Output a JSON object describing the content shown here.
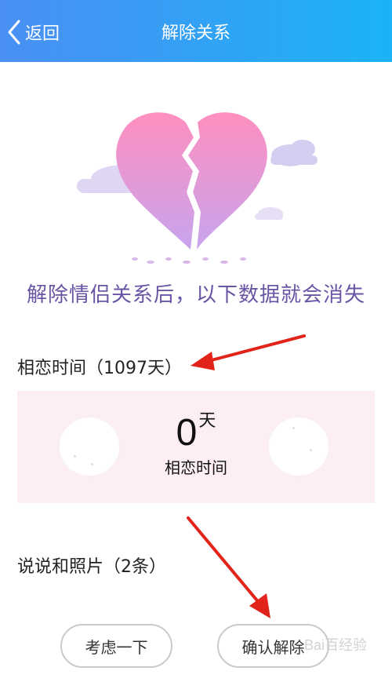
{
  "header": {
    "back_label": "返回",
    "title": "解除关系",
    "gradient_start": "#4a8ff3",
    "gradient_end": "#1bb3f5"
  },
  "main": {
    "headline": "解除情侣关系后，以下数据就会消失",
    "relationship_time": {
      "label": "相恋时间（1097天）",
      "days_value": "0",
      "days_unit": "天",
      "days_caption": "相恋时间"
    },
    "posts": {
      "label": "说说和照片（2条）"
    }
  },
  "footer": {
    "cancel_label": "考虑一下",
    "confirm_label": "确认解除"
  },
  "watermark": "Bai百经验",
  "colors": {
    "headline": "#6a55a5",
    "card_background": "#fdeef3",
    "annotation_arrow": "#e2231a"
  },
  "icons": [
    "back-chevron-icon",
    "broken-heart-illustration",
    "cloud-icon",
    "annotation-arrow"
  ]
}
